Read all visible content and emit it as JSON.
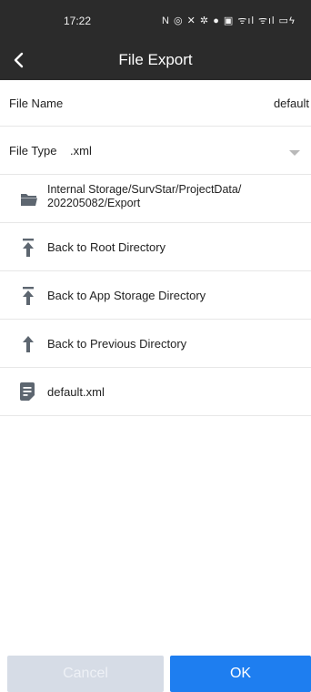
{
  "status_bar": {
    "time": "17:22",
    "icons_text": "N ◎ ✕ ✲ ● ▣ ᯤıl ᯤıl ▭ϟ"
  },
  "header": {
    "title": "File Export"
  },
  "form": {
    "file_name_label": "File Name",
    "file_name_value": "default",
    "file_type_label": "File Type",
    "file_type_value": ".xml"
  },
  "browser": {
    "current_path": "Internal Storage/SurvStar/ProjectData/\n202205082/Export",
    "items": [
      {
        "label": "Back to Root Directory",
        "icon": "arrow-up-to-top-icon"
      },
      {
        "label": "Back to App Storage Directory",
        "icon": "arrow-up-to-top-icon"
      },
      {
        "label": "Back to Previous Directory",
        "icon": "arrow-up-icon"
      },
      {
        "label": "default.xml",
        "icon": "file-icon"
      }
    ]
  },
  "footer": {
    "cancel_label": "Cancel",
    "ok_label": "OK"
  },
  "colors": {
    "header_bg": "#2b2b2b",
    "ok_button": "#1e7ef0",
    "cancel_button": "#d6dce6",
    "icon_gray": "#5d6670"
  }
}
